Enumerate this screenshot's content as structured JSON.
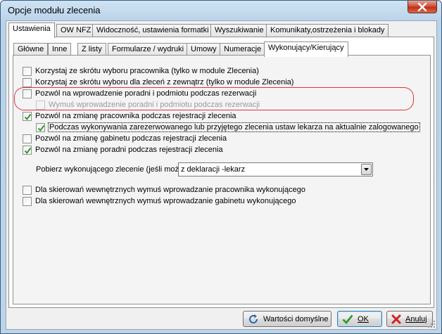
{
  "window": {
    "title": "Opcje modułu zlecenia"
  },
  "main_tabs": [
    {
      "label": "Ustawienia"
    },
    {
      "label": "OW NFZ"
    },
    {
      "label": "Widoczność, ustawienia formatki"
    },
    {
      "label": "Wyszukiwanie"
    },
    {
      "label": "Komunikaty,ostrzeżenia i blokady"
    }
  ],
  "sub_tabs": [
    {
      "label": "Główne"
    },
    {
      "label": "Inne"
    },
    {
      "label": "Z listy"
    },
    {
      "label": "Formularze / wydruki"
    },
    {
      "label": "Umowy"
    },
    {
      "label": "Numeracje"
    },
    {
      "label": "Wykonujący/Kierujący"
    }
  ],
  "options": [
    {
      "label": "Korzystaj ze skrótu wyboru pracownika (tylko w module Zlecenia)",
      "checked": false,
      "enabled": true
    },
    {
      "label": "Korzystaj ze skrótu wyboru dla zleceń z zewnątrz (tylko w module Zlecenia)",
      "checked": false,
      "enabled": true
    },
    {
      "label": "Pozwól na wprowadzenie poradni i podmiotu podczas rezerwacji",
      "checked": false,
      "enabled": true
    },
    {
      "label": "Wymuś wprowadzenie poradni i podmiotu podczas rezerwacji",
      "checked": false,
      "enabled": false
    },
    {
      "label": "Pozwól na zmianę pracownika podczas rejestracji zlecenia",
      "checked": true,
      "enabled": true
    },
    {
      "label": "Podczas wykonywania zarezerwowanego lub przyjętego zlecenia ustaw lekarza na aktualnie zalogowanego",
      "checked": true,
      "enabled": true
    },
    {
      "label": "Pozwól na zmianę gabinetu podczas rejestracji zlecenia",
      "checked": false,
      "enabled": true
    },
    {
      "label": "Pozwól na zmianę poradni podczas rejestracji zlecenia",
      "checked": true,
      "enabled": true
    }
  ],
  "executor_select": {
    "label": "Pobierz wykonującego zlecenie (jeśli możliwe):",
    "value": "z deklaracji -lekarz"
  },
  "options2": [
    {
      "label": "Dla skierowań wewnętrznych wymuś wprowadzanie pracownika wykonującego",
      "checked": false
    },
    {
      "label": "Dla skierowań wewnętrznych wymuś wprowadzanie gabinetu wykonującego",
      "checked": false
    }
  ],
  "buttons": {
    "defaults": "Wartości domyślne",
    "ok": "OK",
    "cancel": "Anuluj"
  },
  "colors": {
    "highlight": "#e2333a",
    "check": "#2a9a2a"
  }
}
